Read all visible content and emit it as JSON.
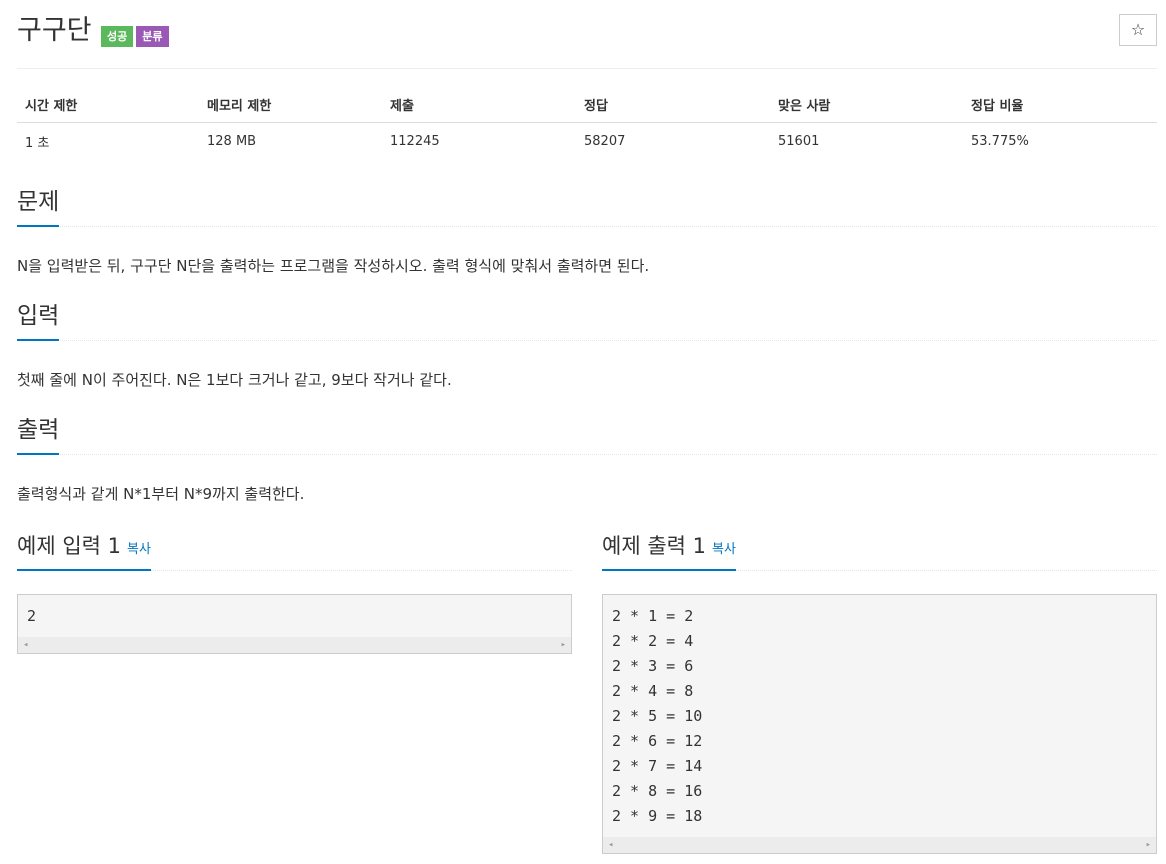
{
  "problem": {
    "title": "구구단",
    "labels": {
      "success": "성공",
      "category": "분류"
    },
    "star_icon": "☆"
  },
  "info_table": {
    "headers": [
      "시간 제한",
      "메모리 제한",
      "제출",
      "정답",
      "맞은 사람",
      "정답 비율"
    ],
    "values": [
      "1 초",
      "128 MB",
      "112245",
      "58207",
      "51601",
      "53.775%"
    ]
  },
  "sections": {
    "problem": {
      "title": "문제",
      "text": "N을 입력받은 뒤, 구구단 N단을 출력하는 프로그램을 작성하시오. 출력 형식에 맞춰서 출력하면 된다."
    },
    "input": {
      "title": "입력",
      "text": "첫째 줄에 N이 주어진다. N은 1보다 크거나 같고, 9보다 작거나 같다."
    },
    "output": {
      "title": "출력",
      "text": "출력형식과 같게 N*1부터 N*9까지 출력한다."
    }
  },
  "examples": {
    "input": {
      "title": "예제 입력 1",
      "copy": "복사",
      "content": "2"
    },
    "output": {
      "title": "예제 출력 1",
      "copy": "복사",
      "content": "2 * 1 = 2\n2 * 2 = 4\n2 * 3 = 6\n2 * 4 = 8\n2 * 5 = 10\n2 * 6 = 12\n2 * 7 = 14\n2 * 8 = 16\n2 * 9 = 18"
    }
  },
  "icons": {
    "scroll_left": "◂",
    "scroll_right": "▸"
  },
  "colors": {
    "success": "#5cb85c",
    "category": "#9b59b6",
    "accent": "#0076c0"
  }
}
